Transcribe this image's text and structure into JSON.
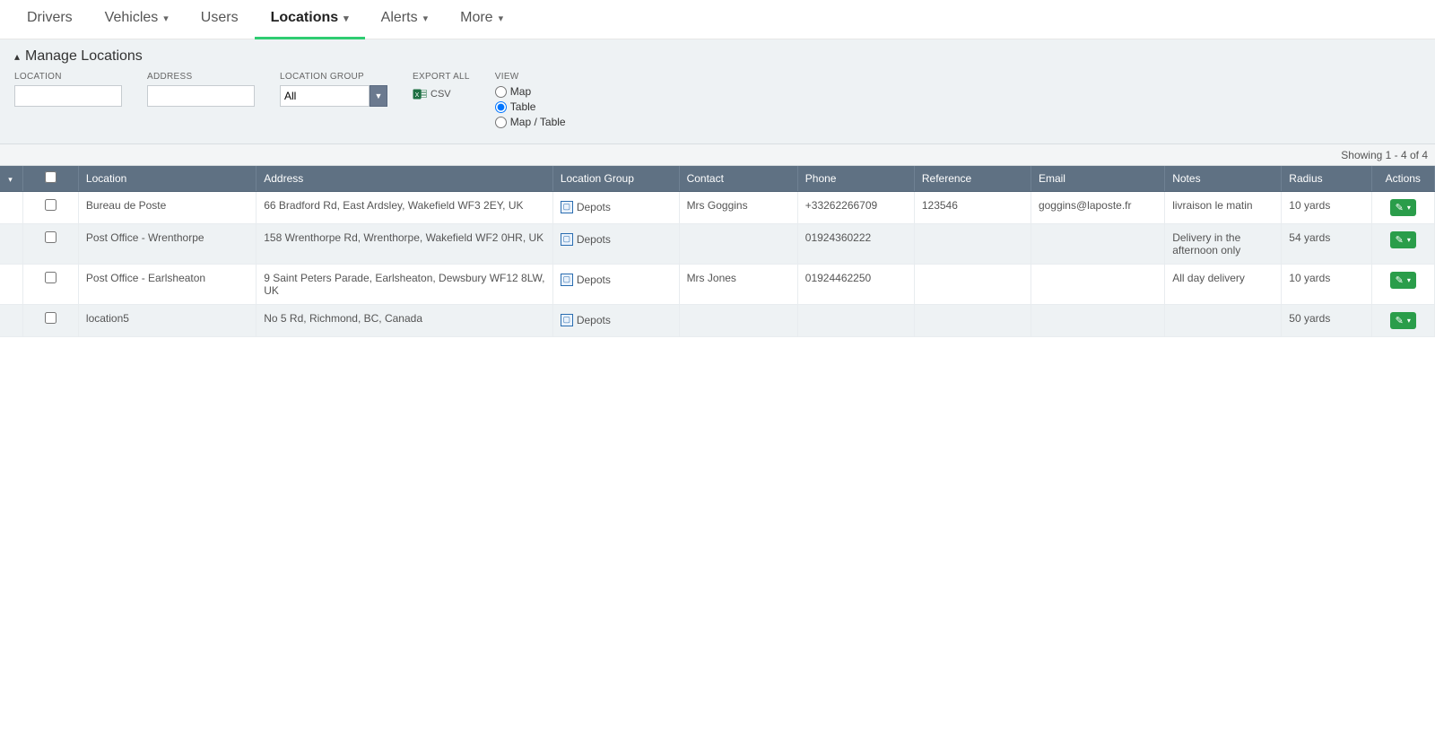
{
  "nav": {
    "items": [
      {
        "label": "Drivers",
        "dropdown": false
      },
      {
        "label": "Vehicles",
        "dropdown": true
      },
      {
        "label": "Users",
        "dropdown": false
      },
      {
        "label": "Locations",
        "dropdown": true,
        "active": true
      },
      {
        "label": "Alerts",
        "dropdown": true
      },
      {
        "label": "More",
        "dropdown": true
      }
    ]
  },
  "filter": {
    "title": "Manage Locations",
    "location_label": "LOCATION",
    "address_label": "ADDRESS",
    "group_label": "LOCATION GROUP",
    "group_value": "All",
    "export_label": "EXPORT ALL",
    "csv_label": "CSV",
    "view_label": "VIEW",
    "view_options": {
      "map": "Map",
      "table": "Table",
      "maptable": "Map / Table"
    },
    "view_selected": "table"
  },
  "results_text": "Showing 1 - 4 of 4",
  "columns": [
    "",
    "",
    "Location",
    "Address",
    "Location Group",
    "Contact",
    "Phone",
    "Reference",
    "Email",
    "Notes",
    "Radius",
    "Actions"
  ],
  "rows": [
    {
      "location": "Bureau de Poste",
      "address": "66 Bradford Rd, East Ardsley, Wakefield WF3 2EY, UK",
      "group": "Depots",
      "contact": "Mrs Goggins",
      "phone": "+33262266709",
      "reference": "123546",
      "email": "goggins@laposte.fr",
      "notes": "livraison le matin",
      "radius": "10 yards"
    },
    {
      "location": "Post Office - Wrenthorpe",
      "address": "158 Wrenthorpe Rd, Wrenthorpe, Wakefield WF2 0HR, UK",
      "group": "Depots",
      "contact": "",
      "phone": "01924360222",
      "reference": "",
      "email": "",
      "notes": "Delivery in the afternoon only",
      "radius": "54 yards"
    },
    {
      "location": "Post Office - Earlsheaton",
      "address": "9 Saint Peters Parade, Earlsheaton, Dewsbury WF12 8LW, UK",
      "group": "Depots",
      "contact": "Mrs Jones",
      "phone": "01924462250",
      "reference": "",
      "email": "",
      "notes": "All day delivery",
      "radius": "10 yards"
    },
    {
      "location": "location5",
      "address": "No 5 Rd, Richmond, BC, Canada",
      "group": "Depots",
      "contact": "",
      "phone": "",
      "reference": "",
      "email": "",
      "notes": "",
      "radius": "50 yards"
    }
  ]
}
